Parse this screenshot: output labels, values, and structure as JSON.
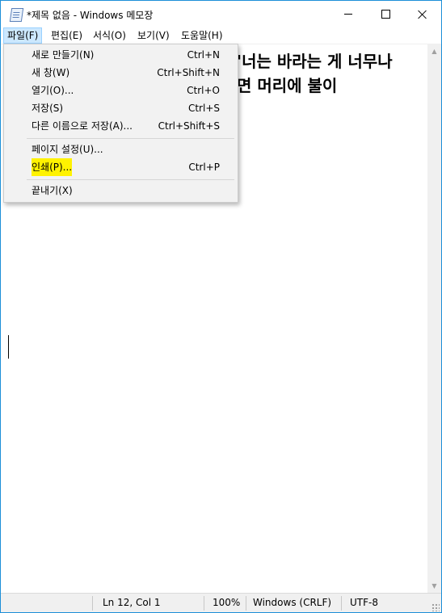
{
  "window": {
    "title": "*제목 없음 - Windows 메모장"
  },
  "menubar": {
    "items": [
      {
        "label": "파일(F)"
      },
      {
        "label": "편집(E)"
      },
      {
        "label": "서식(O)"
      },
      {
        "label": "보기(V)"
      },
      {
        "label": "도움말(H)"
      }
    ],
    "active_index": 0
  },
  "file_menu": {
    "items": [
      {
        "label": "새로 만들기(N)",
        "shortcut": "Ctrl+N"
      },
      {
        "label": "새 창(W)",
        "shortcut": "Ctrl+Shift+N"
      },
      {
        "label": "열기(O)...",
        "shortcut": "Ctrl+O"
      },
      {
        "label": "저장(S)",
        "shortcut": "Ctrl+S"
      },
      {
        "label": "다른 이름으로 저장(A)...",
        "shortcut": "Ctrl+Shift+S"
      },
      {
        "label": "페이지 설정(U)...",
        "shortcut": ""
      },
      {
        "label": "인쇄(P)...",
        "shortcut": "Ctrl+P",
        "highlighted": true
      },
      {
        "label": "끝내기(X)",
        "shortcut": ""
      }
    ]
  },
  "editor": {
    "visible_lines": [
      "'너는 바라는 게 너무나",
      "면 머리에 불이"
    ]
  },
  "statusbar": {
    "position": "Ln 12, Col 1",
    "zoom": "100%",
    "line_ending": "Windows (CRLF)",
    "encoding": "UTF-8"
  },
  "colors": {
    "window_border": "#1c8fd8",
    "menu_active_bg": "#cce8ff",
    "highlight": "#fff200"
  }
}
